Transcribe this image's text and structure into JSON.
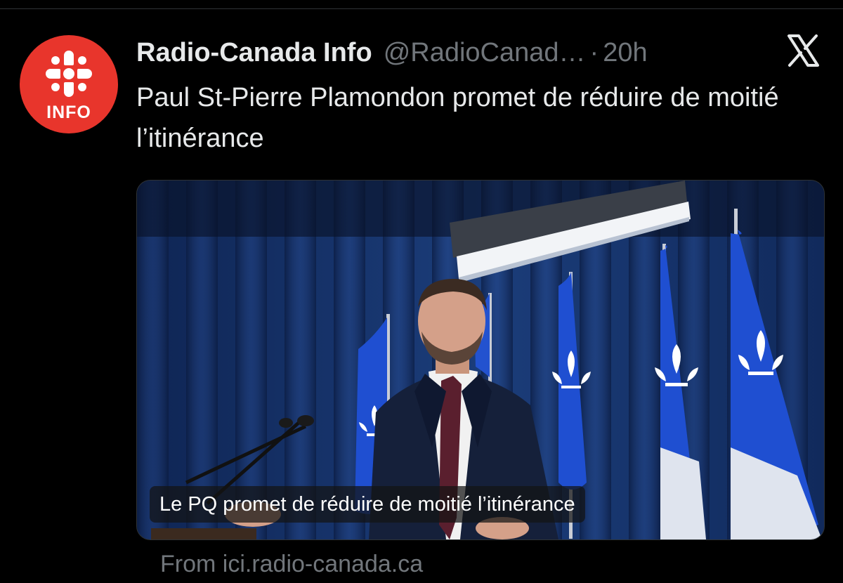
{
  "tweet": {
    "avatar": {
      "label": "INFO",
      "color": "#e8352c"
    },
    "display_name": "Radio-Canada Info",
    "handle": "@RadioCanad…",
    "separator": "·",
    "time": "20h",
    "platform_icon": "x-logo-icon",
    "text": "Paul St-Pierre Plamondon promet de réduire de moitié l’itinérance",
    "card": {
      "image": "photo-politician-at-podium-with-quebec-flags",
      "caption": "Le PQ promet de réduire de moitié l’itinérance"
    },
    "source": "From ici.radio-canada.ca"
  },
  "colors": {
    "background": "#000000",
    "text_primary": "#e7e9ea",
    "text_secondary": "#71767b",
    "brand_red": "#e8352c",
    "curtain_blue": "#1b3d7a",
    "flag_blue": "#1f4fd1"
  }
}
